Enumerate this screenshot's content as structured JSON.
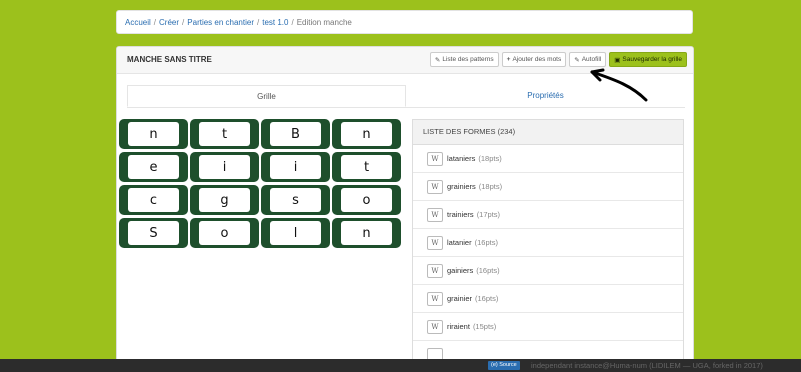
{
  "breadcrumb": {
    "items": [
      "Accueil",
      "Créer",
      "Parties en chantier",
      "test 1.0"
    ],
    "current": "Edition manche"
  },
  "panel": {
    "title": "MANCHE SANS TITRE"
  },
  "toolbar": {
    "patterns_label": "Liste des patterns",
    "add_words_label": "Ajouter des mots",
    "autofill_label": "Autofill",
    "save_label": "Sauvegarder la grille"
  },
  "tabs": {
    "grid": "Grille",
    "properties": "Propriétés"
  },
  "grid": [
    [
      "n",
      "t",
      "B",
      "n"
    ],
    [
      "e",
      "i",
      "i",
      "t"
    ],
    [
      "c",
      "g",
      "s",
      "o"
    ],
    [
      "S",
      "o",
      "l",
      "n"
    ]
  ],
  "forms": {
    "header": "LISTE DES FORMES (234)",
    "wiki_glyph": "W",
    "items": [
      {
        "word": "lataniers",
        "pts": "(18pts)"
      },
      {
        "word": "grainiers",
        "pts": "(18pts)"
      },
      {
        "word": "trainiers",
        "pts": "(17pts)"
      },
      {
        "word": "latanier",
        "pts": "(16pts)"
      },
      {
        "word": "gainiers",
        "pts": "(16pts)"
      },
      {
        "word": "grainier",
        "pts": "(16pts)"
      },
      {
        "word": "riraient",
        "pts": "(15pts)"
      }
    ]
  },
  "footer": {
    "source_label": "Source",
    "note": "independant instance@Huma-num (LIDILEM — UGA, forked in 2017)"
  },
  "colors": {
    "accent": "#9cc11c",
    "tile": "#1e4f2c",
    "link": "#2a6db0"
  }
}
